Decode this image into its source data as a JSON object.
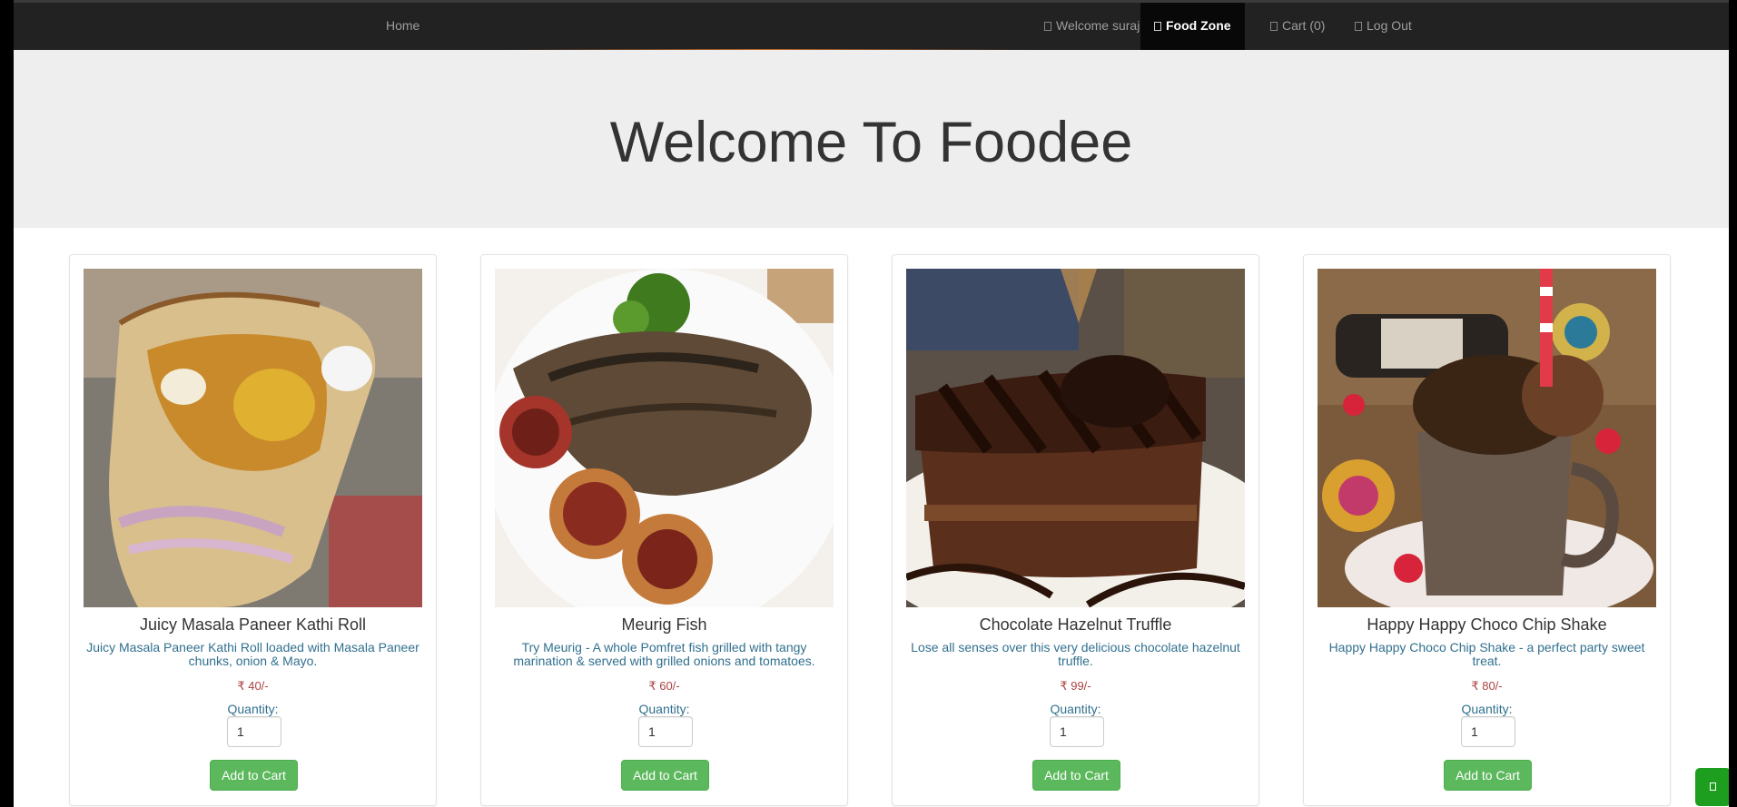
{
  "navbar": {
    "home_label": "Home",
    "welcome_label": "Welcome suraj",
    "food_zone_label": "Food Zone",
    "cart_label": "Cart (0)",
    "logout_label": "Log Out"
  },
  "hero": {
    "title": "Welcome To Foodee"
  },
  "common": {
    "quantity_label": "Quantity:",
    "add_to_cart_label": "Add to Cart",
    "accent_color": "#5cb85c"
  },
  "products": [
    {
      "name": "Juicy Masala Paneer Kathi Roll",
      "description": "Juicy Masala Paneer Kathi Roll loaded with Masala Paneer chunks, onion & Mayo.",
      "price": "₹ 40/-",
      "quantity": "1",
      "image_icon": "kathi-roll-photo"
    },
    {
      "name": "Meurig Fish",
      "description": "Try Meurig - A whole Pomfret fish grilled with tangy marination & served with grilled onions and tomatoes.",
      "price": "₹ 60/-",
      "quantity": "1",
      "image_icon": "grilled-fish-photo"
    },
    {
      "name": "Chocolate Hazelnut Truffle",
      "description": "Lose all senses over this very delicious chocolate hazelnut truffle.",
      "price": "₹ 99/-",
      "quantity": "1",
      "image_icon": "chocolate-cake-photo"
    },
    {
      "name": "Happy Happy Choco Chip Shake",
      "description": "Happy Happy Choco Chip Shake - a perfect party sweet treat.",
      "price": "₹ 80/-",
      "quantity": "1",
      "image_icon": "choco-shake-photo"
    }
  ]
}
